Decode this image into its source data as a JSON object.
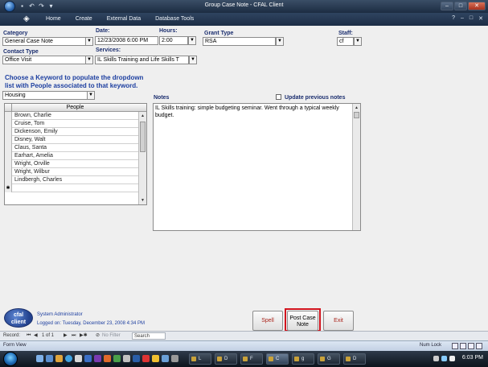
{
  "window": {
    "title": "Group Case Note - CFAL Client",
    "controls": [
      "–",
      "□",
      "✕"
    ]
  },
  "ribbon": {
    "tabs": [
      "Home",
      "Create",
      "External Data",
      "Database Tools"
    ],
    "right_controls": [
      "?",
      "–",
      "□",
      "✕"
    ]
  },
  "form": {
    "category": {
      "label": "Category",
      "value": "General Case Note"
    },
    "date": {
      "label": "Date:",
      "value": "12/23/2008 6:00 PM"
    },
    "hours": {
      "label": "Hours:",
      "value": "2:00"
    },
    "grant_type": {
      "label": "Grant Type",
      "value": "RSA"
    },
    "staff": {
      "label": "Staff:",
      "value": "cf"
    },
    "contact_type": {
      "label": "Contact Type",
      "value": "Office Visit"
    },
    "services": {
      "label": "Services:",
      "value": "IL Skills Training and Life Skills T"
    },
    "keyword_prompt_line1": "Choose a Keyword to populate the dropdown",
    "keyword_prompt_line2": "list with People associated to that keyword.",
    "keyword": {
      "value": "Housing"
    },
    "people": {
      "header": "People",
      "rows": [
        "Brown, Charlie",
        "Cruise, Tom",
        "Dickenson, Emily",
        "Disney, Walt",
        "Claus, Santa",
        "Earhart, Amelia",
        "Wright, Orville",
        "Wright, Wilbur",
        "Lindbergh, Charles",
        ""
      ],
      "new_row_marker": "✱"
    },
    "notes": {
      "label": "Notes",
      "text": "IL Skills training: simple budgeting seminar. Went through a typical weekly budget."
    },
    "update_previous_notes": {
      "label": "Update previous notes",
      "checked": false
    }
  },
  "footer": {
    "logo_text_1": "cfal",
    "logo_text_2": "client",
    "user": "System Administrator",
    "logged_on": "Logged on: Tuesday, December 23, 2008 4:34 PM",
    "buttons": {
      "spell_check": "Spell Check",
      "post_line1": "Post Case",
      "post_line2": "Note",
      "exit": "Exit"
    }
  },
  "record_nav": {
    "label": "Record:",
    "position": "1 of 1",
    "first": "⏮",
    "prev": "◀",
    "next": "▶",
    "last": "⏭",
    "new": "▶✱",
    "filter": "No Filter",
    "search": "Search"
  },
  "status": {
    "view": "Form View",
    "num_lock": "Num Lock"
  },
  "taskbar": {
    "tasks": [
      "L",
      "D",
      "F",
      "C",
      "g",
      "G",
      "D"
    ],
    "clock": "6:03 PM"
  },
  "colors": {
    "highlight": "#d2141e",
    "label_blue": "#1a2d6e",
    "prompt_blue": "#1d3fa0"
  }
}
